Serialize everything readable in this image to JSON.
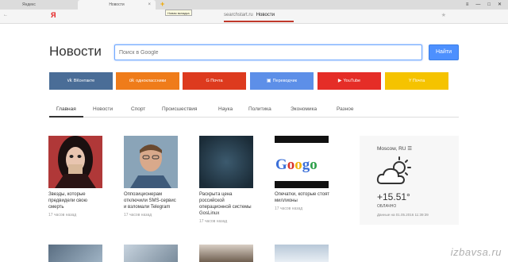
{
  "browser": {
    "tab_inactive": "Яндекс",
    "tab_active": "Новости",
    "tab_close": "×",
    "new_tab_plus": "+",
    "tooltip": "Новая вкладка",
    "yandex_logo": "Я",
    "url_host": "searchstart.ru",
    "url_title": "Новости",
    "star": "★",
    "window_buttons": [
      "≡",
      "—",
      "□",
      "✕"
    ],
    "nav_back": "←"
  },
  "page": {
    "title": "Новости",
    "search_placeholder": "Поиск в Google",
    "search_button": "Найти"
  },
  "services": [
    {
      "label": "ВКонтакте",
      "icon": "vk-icon",
      "glyph": "vk",
      "color": "#4a6d97"
    },
    {
      "label": "одноклассники",
      "icon": "ok-icon",
      "glyph": "ok",
      "color": "#ef7c1a"
    },
    {
      "label": "G Почта",
      "icon": "gmail-icon",
      "glyph": "",
      "color": "#dd3a1e"
    },
    {
      "label": "Переводчик",
      "icon": "translate-icon",
      "glyph": "▣",
      "color": "#5d8fe8"
    },
    {
      "label": "YouTube",
      "icon": "youtube-icon",
      "glyph": "▶",
      "color": "#e52d27"
    },
    {
      "label": "Y Почта",
      "icon": "yandex-mail-icon",
      "glyph": "",
      "color": "#f5c300"
    }
  ],
  "nav_tabs": [
    "Главная",
    "Новости",
    "Спорт",
    "Происшествия",
    "Наука",
    "Политика",
    "Экономика",
    "Разное"
  ],
  "news": [
    {
      "caption": "Звезды, которые предвидели свою смерть",
      "ago": "17 часов назад"
    },
    {
      "caption": "Оппозиционерам отключили SMS-сервис и взломали Telegram",
      "ago": "17 часов назад"
    },
    {
      "caption": "Раскрыта цена российской операционной системы GosLinux",
      "ago": "17 часов назад"
    },
    {
      "caption": "Опечатки, которые стоят миллионы",
      "ago": "17 часов назад"
    }
  ],
  "weather": {
    "city": "Moscow, RU ☰",
    "temp": "+15.51°",
    "desc": "ОБЛАЧНО",
    "date": "Данные на 01.05.2016 11:39:39",
    "icon": "cloud-sun-icon"
  },
  "watermark": "izbavsa.ru"
}
